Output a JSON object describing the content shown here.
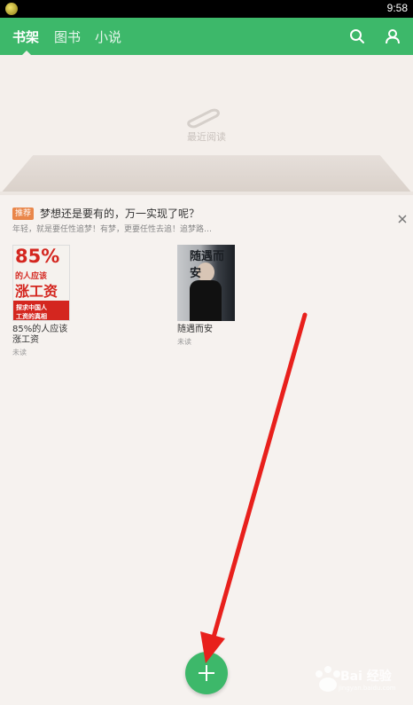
{
  "status_bar": {
    "time": "9:58"
  },
  "nav": {
    "tabs": [
      {
        "label": "书架",
        "active": true
      },
      {
        "label": "图书",
        "active": false
      },
      {
        "label": "小说",
        "active": false
      }
    ],
    "icons": [
      "search-icon",
      "user-icon"
    ]
  },
  "recent": {
    "label": "最近阅读"
  },
  "recommend": {
    "badge": "推荐",
    "title": "梦想还是要有的，万一实现了呢？",
    "subtitle": "年轻，就是要任性追梦！有梦，更要任性去追！追梦路…",
    "books": [
      {
        "title_line1": "85%的人应该",
        "title_line2": "涨工资",
        "status": "未读",
        "cover_text": {
          "big": "85%",
          "line1": "的人应该",
          "line2": "涨工资",
          "band1": "探求中国人",
          "band2": "工资的真相"
        }
      },
      {
        "title_line1": "随遇而安",
        "title_line2": "",
        "status": "未读",
        "cover_text": {
          "title": "随遇而安"
        }
      }
    ]
  },
  "colors": {
    "accent": "#3db86a",
    "badge": "#e9864a",
    "annotation": "#e8201c"
  },
  "watermark": {
    "text": "Bai 经验",
    "sub": "jingyan.baidu.com"
  }
}
